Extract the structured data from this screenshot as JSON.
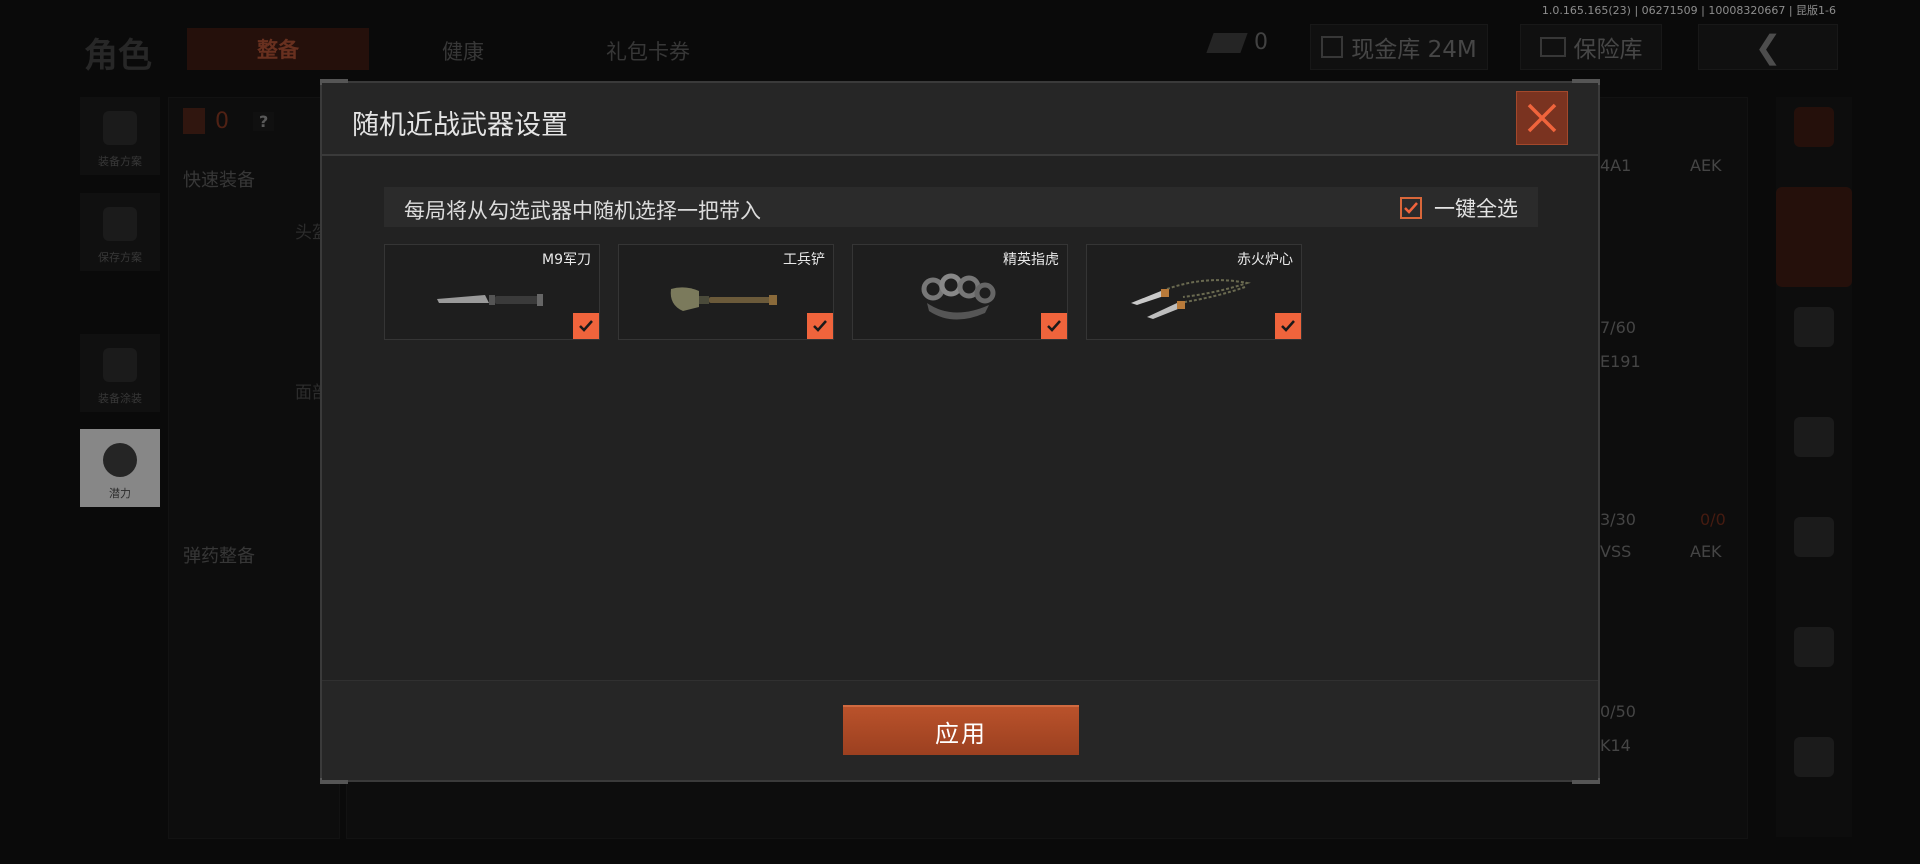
{
  "version": "1.0.165.165(23) | 06271509 | 10008320667 | 昆版1-6",
  "background": {
    "page_title": "角色",
    "tabs": [
      {
        "label": "整备",
        "active": true
      },
      {
        "label": "健康",
        "active": false
      },
      {
        "label": "礼包卡券",
        "active": false
      }
    ],
    "ticket_count": "0",
    "cash_vault": "现金库 24M",
    "safe_vault": "保险库",
    "left_nav": [
      {
        "label": "装备方案"
      },
      {
        "label": "保存方案"
      },
      {
        "label": "装备涂装"
      },
      {
        "label": "潜力"
      }
    ],
    "armor_count": "0",
    "help_label": "?",
    "quick_equip": "快速装备",
    "head_label": "头盔",
    "face_label": "面部",
    "ammo_equip": "弹药整备",
    "right_labels": [
      "4A1",
      "AEK",
      "7/60",
      "E191",
      "3/30",
      "0/0",
      "VSS",
      "AEK",
      "0/50",
      "K14"
    ]
  },
  "modal": {
    "title": "随机近战武器设置",
    "description": "每局将从勾选武器中随机选择一把带入",
    "select_all_label": "一键全选",
    "select_all_checked": true,
    "weapons": [
      {
        "name": "M9军刀",
        "checked": true,
        "icon": "knife-icon"
      },
      {
        "name": "工兵铲",
        "checked": true,
        "icon": "shovel-icon"
      },
      {
        "name": "精英指虎",
        "checked": true,
        "icon": "knuckles-icon"
      },
      {
        "name": "赤火炉心",
        "checked": true,
        "icon": "dual-blades-icon"
      }
    ],
    "apply_label": "应用"
  },
  "colors": {
    "accent": "#f0643c",
    "close_bg": "#7a3320",
    "apply_bg": "#b9522b"
  }
}
